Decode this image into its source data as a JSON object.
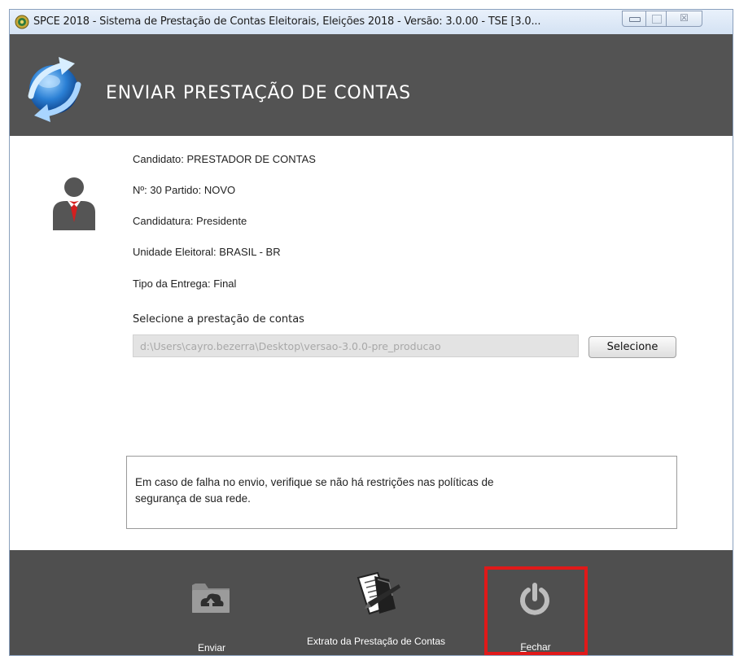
{
  "window": {
    "title": "SPCE 2018 - Sistema de Prestação de Contas Eleitorais, Eleições 2018 - Versão: 3.0.00  -  TSE [3.0...",
    "controls": {
      "minimize_icon": "minimize-icon",
      "maximize_icon": "maximize-icon",
      "close_glyph": "☒"
    }
  },
  "header": {
    "title": "ENVIAR PRESTAÇÃO DE CONTAS",
    "logo_icon": "sync-globe-icon"
  },
  "candidate": {
    "avatar_icon": "candidate-avatar-icon",
    "name_line": "Candidato: PRESTADOR DE CONTAS",
    "number_party_line": "Nº: 30 Partido: NOVO",
    "candidacy_line": "Candidatura: Presidente",
    "unit_line": "Unidade Eleitoral: BRASIL - BR",
    "delivery_type_line": "Tipo da Entrega: Final"
  },
  "selection": {
    "label": "Selecione a prestação de contas",
    "path_value": "d:\\Users\\cayro.bezerra\\Desktop\\versao-3.0.0-pre_producao",
    "button_label": "Selecione"
  },
  "notice": {
    "line1": "Em caso de falha no envio, verifique se não há restrições nas políticas de",
    "line2": "segurança de sua rede."
  },
  "footer": {
    "send": {
      "label": "Enviar",
      "icon": "cloud-upload-folder-icon"
    },
    "statement": {
      "label": "Extrato da Prestação de Contas",
      "icon": "document-statement-icon"
    },
    "close": {
      "label_first": "F",
      "label_rest": "echar",
      "icon": "power-icon"
    },
    "highlight_color": "#e01919"
  },
  "colors": {
    "header_bg": "#535353",
    "footer_bg": "#4f4f4f",
    "highlight": "#e01919"
  }
}
